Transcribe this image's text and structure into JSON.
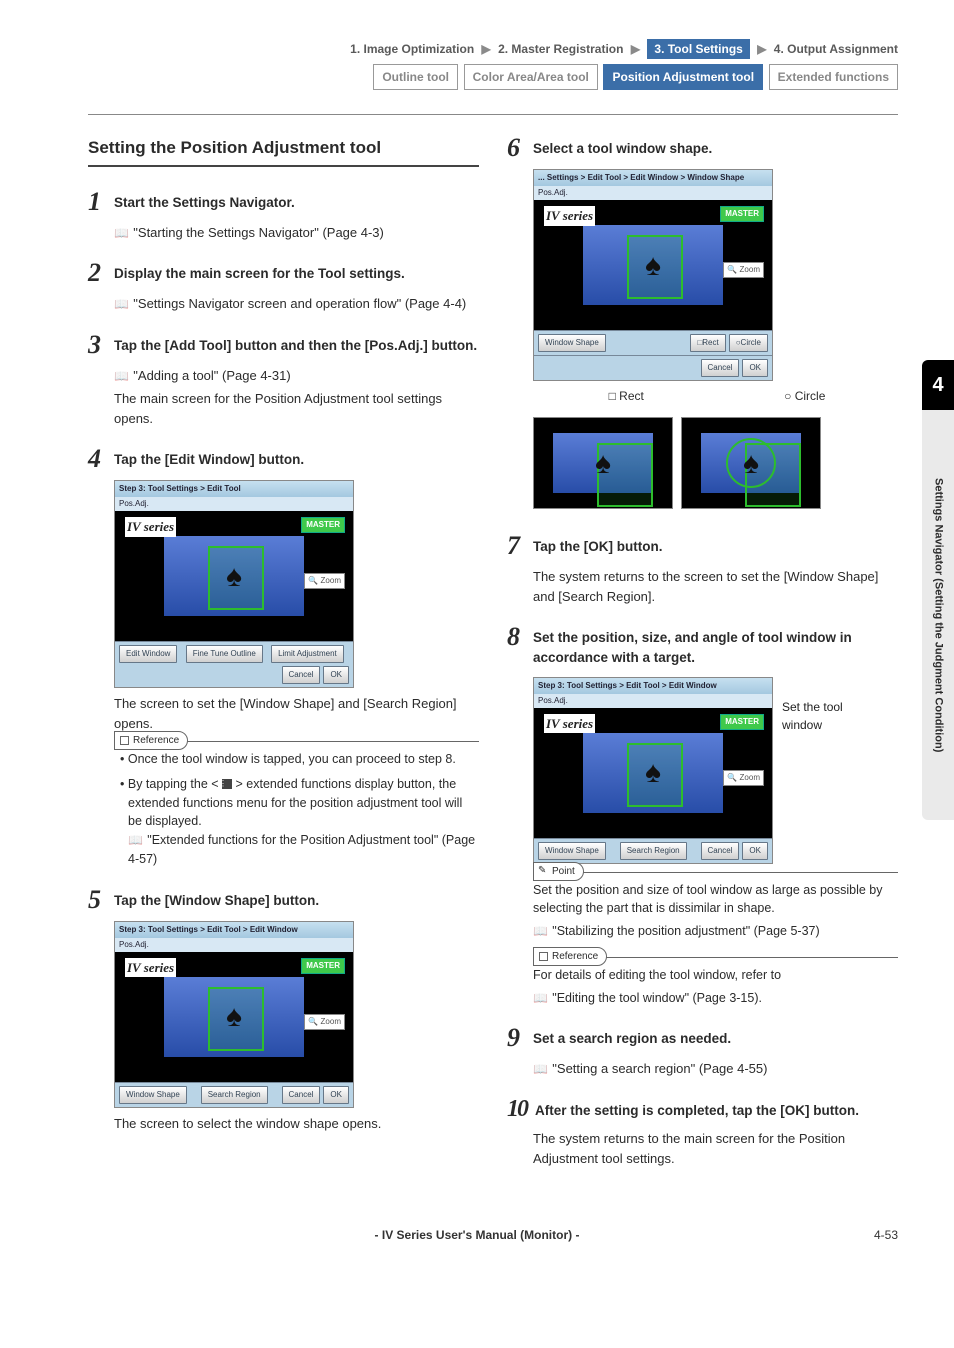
{
  "nav": {
    "items": [
      "1. Image Optimization",
      "2. Master Registration",
      "3. Tool Settings",
      "4. Output Assignment"
    ],
    "activeIndex": 2
  },
  "tools": {
    "items": [
      "Outline tool",
      "Color Area/Area tool",
      "Position Adjustment tool",
      "Extended functions"
    ],
    "activeIndex": 2
  },
  "sideTab": {
    "num": "4",
    "label": "Settings Navigator (Setting the Judgment Condition)"
  },
  "section_title": "Setting the Position Adjustment tool",
  "steps": {
    "s1": {
      "title": "Start the Settings Navigator.",
      "ref": "\"Starting the Settings Navigator\" (Page 4-3)"
    },
    "s2": {
      "title": "Display the main screen for the Tool settings.",
      "ref": "\"Settings Navigator screen and operation flow\" (Page 4-4)"
    },
    "s3": {
      "title": "Tap the [Add Tool] button and then the [Pos.Adj.] button.",
      "ref": "\"Adding a tool\" (Page 4-31)",
      "text": "The main screen for the Position Adjustment tool settings opens."
    },
    "s4": {
      "title": "Tap the [Edit Window] button.",
      "after": "The screen to set the [Window Shape] and [Search Region] opens."
    },
    "s4ref": {
      "label": "Reference",
      "b1a": "Once the tool window is tapped, you can proceed to step 8.",
      "b2a": "By tapping the < ",
      "b2b": " > extended functions display button, the extended functions menu for the position adjustment tool will be displayed.",
      "b2ref": "\"Extended functions for the Position Adjustment tool\" (Page 4-57)"
    },
    "s5": {
      "title": "Tap the [Window Shape] button.",
      "after": "The screen to select the window shape opens."
    },
    "s6": {
      "title": "Select a tool window shape.",
      "rect": "□ Rect",
      "circle": "○ Circle"
    },
    "s7": {
      "title": "Tap the [OK] button.",
      "text": "The system returns to the screen to set the [Window Shape] and [Search Region]."
    },
    "s8": {
      "title": "Set the position, size, and angle of tool window in accordance with a target.",
      "annot": "Set the tool window"
    },
    "s8point": {
      "label": "Point",
      "text": "Set the position and size of tool window as large as possible by selecting the part that is dissimilar in shape.",
      "ref": "\"Stabilizing the position adjustment\" (Page 5-37)"
    },
    "s8ref": {
      "label": "Reference",
      "text": "For details of editing the tool window, refer to",
      "ref": "\"Editing the tool window\" (Page 3-15)."
    },
    "s9": {
      "title": "Set a search region as needed.",
      "ref": "\"Setting a search region\" (Page 4-55)"
    },
    "s10": {
      "title": "After the setting is completed, tap the [OK] button.",
      "text": "The system returns to the main screen for the Position Adjustment tool settings."
    }
  },
  "screenshots": {
    "iv": "IV series",
    "master": "MASTER",
    "zoom": "🔍 Zoom",
    "shot4": {
      "crumb": "Step 3: Tool Settings > Edit Tool",
      "crumb2": "Pos.Adj.",
      "btns": [
        "Edit Window",
        "Fine Tune Outline",
        "Limit Adjustment",
        "Cancel",
        "OK"
      ]
    },
    "shot5": {
      "crumb": "Step 3: Tool Settings > Edit Tool > Edit Window",
      "crumb2": "Pos.Adj.",
      "btns": [
        "Window Shape",
        "Search Region",
        "Cancel",
        "OK"
      ]
    },
    "shot6": {
      "crumb": "... Settings > Edit Tool > Edit Window > Window Shape",
      "crumb2": "Pos.Adj.",
      "wslabel": "Window Shape",
      "btns": [
        "□Rect",
        "○Circle",
        "Cancel",
        "OK"
      ]
    },
    "shot8": {
      "crumb": "Step 3: Tool Settings > Edit Tool > Edit Window",
      "crumb2": "Pos.Adj.",
      "btns": [
        "Window Shape",
        "Search Region",
        "Cancel",
        "OK"
      ]
    }
  },
  "footer": {
    "title": "- IV Series User's Manual (Monitor) -",
    "page": "4-53"
  }
}
